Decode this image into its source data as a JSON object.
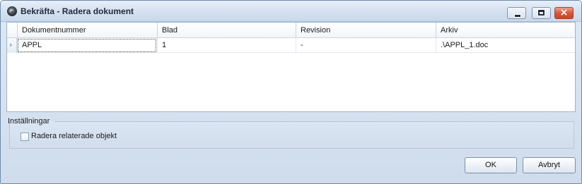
{
  "window": {
    "title": "Bekräfta - Radera dokument",
    "controls": {
      "minimize": "minimize-icon",
      "maximize": "maximize-icon",
      "close": "×"
    }
  },
  "grid": {
    "columns": [
      "Dokumentnummer",
      "Blad",
      "Revision",
      "Arkiv"
    ],
    "rows": [
      {
        "indicator": "›",
        "cells": [
          "APPL",
          "1",
          "-",
          ".\\APPL_1.doc"
        ]
      }
    ]
  },
  "settings": {
    "legend": "Inställningar",
    "delete_related_label": "Radera relaterade objekt",
    "delete_related_checked": false
  },
  "buttons": {
    "ok": "OK",
    "cancel": "Avbryt"
  },
  "colors": {
    "window_bg": "#d6e2f1",
    "close_button": "#d9573b",
    "row_indicator_arrow": "#4a78b0"
  }
}
